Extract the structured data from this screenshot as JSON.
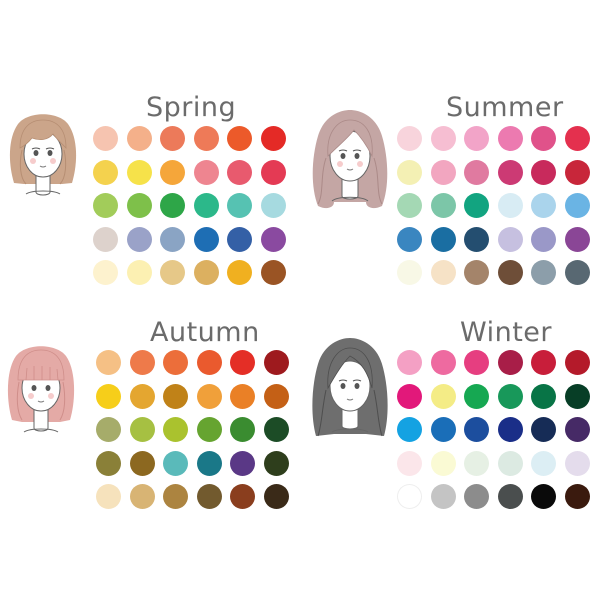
{
  "seasons": [
    {
      "title": "Spring",
      "face": {
        "hair": "#cba58a",
        "hair_dark": "#b68e73",
        "style": "bob-bangs"
      },
      "colors": [
        [
          "#f6c4b0",
          "#f4b08a",
          "#ec7a5a",
          "#ee7a58",
          "#ec5a2a",
          "#e42a26"
        ],
        [
          "#f4d24e",
          "#f6e24a",
          "#f5a63a",
          "#ee8590",
          "#e85a6e",
          "#e43a54"
        ],
        [
          "#a2cc5a",
          "#7ec04a",
          "#2ea648",
          "#2cb88a",
          "#56c2b2",
          "#a6dae0"
        ],
        [
          "#ddd2cc",
          "#9aa2c8",
          "#8aa4c4",
          "#1e6eb4",
          "#3460a6",
          "#8a4aa0"
        ],
        [
          "#fdf2ce",
          "#fcf0b2",
          "#e6c888",
          "#dcb060",
          "#f0b020",
          "#9a5424"
        ]
      ]
    },
    {
      "title": "Summer",
      "face": {
        "hair": "#c4a6a4",
        "hair_dark": "#ab8a88",
        "style": "long-wavy"
      },
      "colors": [
        [
          "#f8d4dc",
          "#f6bed2",
          "#f2a4c8",
          "#ec7ab0",
          "#e0528a",
          "#e4304e"
        ],
        [
          "#f4f0b4",
          "#f2a6c0",
          "#e07aa0",
          "#cc3a74",
          "#c82a5c",
          "#c8263a"
        ],
        [
          "#a4d8b4",
          "#7cc6a8",
          "#12a480",
          "#d8ecf4",
          "#aad4ec",
          "#6ab4e4"
        ],
        [
          "#3a86c0",
          "#1a6ea2",
          "#244e70",
          "#c6c0e0",
          "#9a98c8",
          "#8a4696"
        ],
        [
          "#f8f8e6",
          "#f6e2c6",
          "#a4846a",
          "#6e4e38",
          "#8c9eaa",
          "#586872"
        ]
      ]
    },
    {
      "title": "Autumn",
      "face": {
        "hair": "#e4aaa6",
        "hair_dark": "#cf8e8a",
        "style": "bob-bangs"
      },
      "colors": [
        [
          "#f5c085",
          "#ee7a4a",
          "#ec6e3a",
          "#ea5a2e",
          "#e42e26",
          "#9e1a1e"
        ],
        [
          "#f6ce1a",
          "#e4a630",
          "#c08218",
          "#f0a03a",
          "#ea8026",
          "#c46016"
        ],
        [
          "#a6ac6a",
          "#a6c042",
          "#aac22e",
          "#66a430",
          "#3a8c30",
          "#1c4c26"
        ],
        [
          "#8a8038",
          "#8c6820",
          "#5ababa",
          "#1a7888",
          "#5a3886",
          "#2e3e1c"
        ],
        [
          "#f6e2bc",
          "#d8b474",
          "#ac8440",
          "#725a2e",
          "#8a3e1e",
          "#3a2a18"
        ]
      ]
    },
    {
      "title": "Winter",
      "face": {
        "hair": "#6e6e6e",
        "hair_dark": "#4e4e4e",
        "style": "long-straight"
      },
      "colors": [
        [
          "#f4a0c4",
          "#ee6aa0",
          "#e63e80",
          "#a81e48",
          "#c81e3a",
          "#b41a2a"
        ],
        [
          "#e2187a",
          "#f4ec86",
          "#16a852",
          "#18985a",
          "#087446",
          "#073e26"
        ],
        [
          "#14a2e2",
          "#1a6eb8",
          "#1c4e9e",
          "#1a2e88",
          "#162c56",
          "#462a66"
        ],
        [
          "#fbe6ea",
          "#fafad4",
          "#e6f0e4",
          "#dceae2",
          "#dceef4",
          "#e4dcec"
        ],
        [
          "#ffffff",
          "#c4c4c4",
          "#8c8c8c",
          "#4a4e4e",
          "#0a0a0a",
          "#3a1a0e"
        ]
      ]
    }
  ]
}
